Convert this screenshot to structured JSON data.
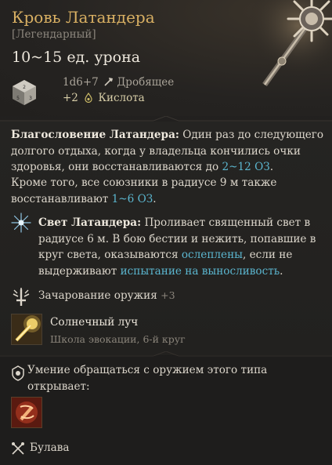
{
  "item": {
    "name": "Кровь Латандера",
    "rarity": "[Легендарный]",
    "damage": "10~15 ед. урона",
    "damage_dice": "1d6+7",
    "damage_type": "Дробящее",
    "bonus_damage": "+2",
    "bonus_type": "Кислота"
  },
  "description": {
    "blessing_title": "Благословение Латандера:",
    "blessing_text1": " Один раз до следующего долгого отдыха, когда у владельца кончились очки здоровья, они восстанавливаются до ",
    "blessing_heal": "2~12 ОЗ",
    "blessing_text2": ".",
    "blessing_text3": "Кроме того, все союзники в радиусе 9 м также восстанавливают ",
    "blessing_heal2": "1~6 ОЗ",
    "blessing_text4": ".",
    "light_title": "Свет Латандера:",
    "light_text1": " Проливает священный свет в радиусе 6 м. В бою бестии и нежить, попавшие в круг света, оказываются ",
    "light_blinded": "ослеплены",
    "light_text2": ", если не выдерживают ",
    "light_save": "испытание на выносливость",
    "light_text3": "."
  },
  "enchant": {
    "label": "Зачарование оружия",
    "value": "+3"
  },
  "spell": {
    "name": "Солнечный луч",
    "school": "Школа эвокации, 6-й круг"
  },
  "proficiency": {
    "text": "Умение обращаться с оружием этого типа открывает:"
  },
  "weapon_type": {
    "label": "Булава"
  },
  "icons": {
    "die": "d6-die-icon",
    "bludgeon": "bludgeoning-icon",
    "acid": "acid-icon",
    "light": "radiant-star-icon",
    "enchant": "weapon-enchant-icon",
    "spell": "sunbeam-spell-icon",
    "proficiency": "proficiency-icon",
    "action": "weapon-action-icon",
    "weapon_type": "mace-icon"
  },
  "colors": {
    "title": "#d9b063",
    "highlight": "#5bb6cf",
    "acid": "#d7cda7"
  }
}
